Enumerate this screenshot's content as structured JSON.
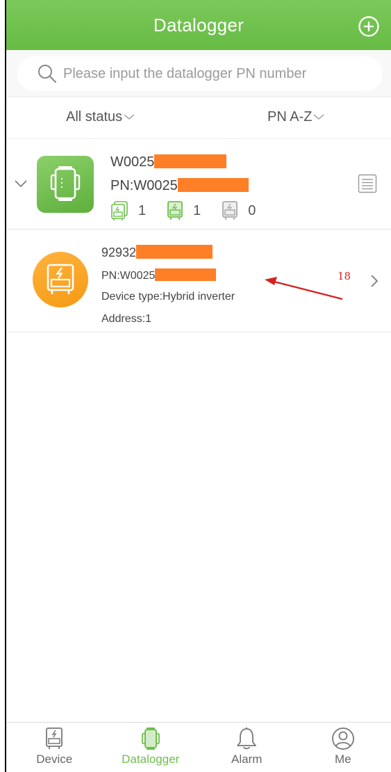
{
  "header": {
    "title": "Datalogger",
    "add_icon": "plus-circle-icon"
  },
  "search": {
    "placeholder": "Please input the datalogger PN number",
    "value": ""
  },
  "filters": {
    "status_label": "All status",
    "sort_label": "PN A-Z"
  },
  "datalogger": {
    "name_prefix": "W0025",
    "pn_prefix": "PN:W0025",
    "counts": [
      {
        "icon": "device-total-icon",
        "value": "1"
      },
      {
        "icon": "device-online-icon",
        "value": "1"
      },
      {
        "icon": "device-offline-icon",
        "value": "0"
      }
    ]
  },
  "device": {
    "sn_prefix": "92932",
    "pn_prefix": "PN:W0025",
    "type": "Device type:Hybrid inverter",
    "address": "Address:1"
  },
  "annotation": {
    "number": "18"
  },
  "tabs": [
    {
      "label": "Device",
      "icon": "inverter-icon",
      "active": false
    },
    {
      "label": "Datalogger",
      "icon": "datalogger-icon",
      "active": true
    },
    {
      "label": "Alarm",
      "icon": "bell-icon",
      "active": false
    },
    {
      "label": "Me",
      "icon": "user-icon",
      "active": false
    }
  ],
  "colors": {
    "brand_green": "#6cc04a",
    "device_orange": "#f7a21c",
    "redaction": "#ff7f27",
    "annotation_red": "#d62020"
  }
}
